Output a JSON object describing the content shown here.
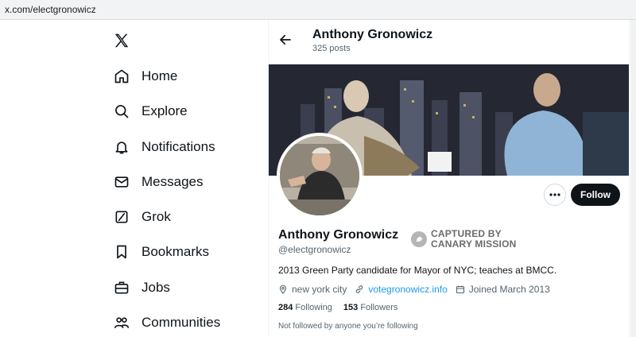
{
  "browser": {
    "url": "x.com/electgronowicz"
  },
  "nav": [
    {
      "label": "Home",
      "icon": "home-icon"
    },
    {
      "label": "Explore",
      "icon": "search-icon"
    },
    {
      "label": "Notifications",
      "icon": "bell-icon"
    },
    {
      "label": "Messages",
      "icon": "mail-icon"
    },
    {
      "label": "Grok",
      "icon": "grok-icon"
    },
    {
      "label": "Bookmarks",
      "icon": "bookmark-icon"
    },
    {
      "label": "Jobs",
      "icon": "briefcase-icon"
    },
    {
      "label": "Communities",
      "icon": "people-icon"
    }
  ],
  "header": {
    "name": "Anthony Gronowicz",
    "posts": "325 posts"
  },
  "profile": {
    "name": "Anthony Gronowicz",
    "handle": "@electgronowicz",
    "badge_line1": "CAPTURED BY",
    "badge_line2": "CANARY MISSION",
    "bio": "2013 Green Party candidate for Mayor of NYC; teaches at BMCC.",
    "location": "new york city",
    "website": "votegronowicz.info",
    "joined": "Joined March 2013",
    "following_count": "284",
    "following_label": "Following",
    "followers_count": "153",
    "followers_label": "Followers",
    "not_followed": "Not followed by anyone you’re following"
  },
  "actions": {
    "follow": "Follow"
  },
  "colors": {
    "link": "#1d9bf0",
    "follow_bg": "#0f1419",
    "muted": "#536471"
  }
}
